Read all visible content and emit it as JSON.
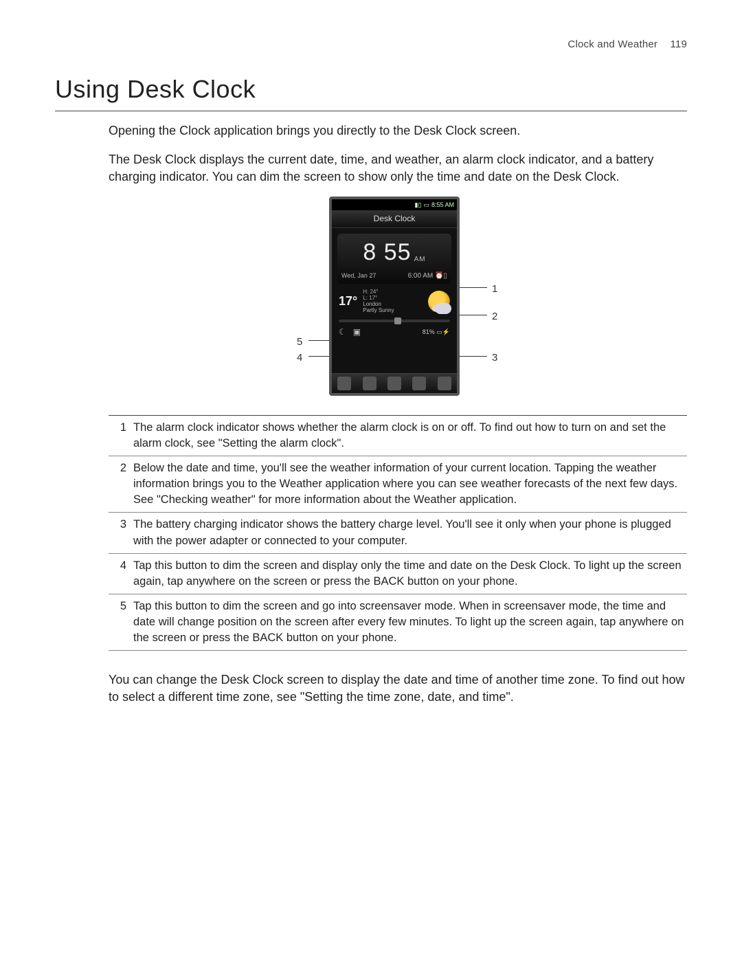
{
  "header": {
    "section": "Clock and Weather",
    "page_number": "119"
  },
  "title": "Using Desk Clock",
  "para1": "Opening the Clock application brings you directly to the Desk Clock screen.",
  "para2": "The Desk Clock displays the current date, time, and weather, an alarm clock indicator, and a battery charging indicator. You can dim the screen to show only the time and date on the Desk Clock.",
  "screenshot": {
    "status_time": "8:55 AM",
    "app_title": "Desk Clock",
    "big_time": "8 55",
    "big_ampm": "AM",
    "date": "Wed, Jan 27",
    "alarm_time": "6:00 AM",
    "temp": "17°",
    "hi": "H: 24°",
    "lo": "L: 17°",
    "city": "London",
    "condition": "Partly Sunny",
    "battery": "81%"
  },
  "callouts": {
    "c1": "1",
    "c2": "2",
    "c3": "3",
    "c4": "4",
    "c5": "5"
  },
  "explain": [
    {
      "num": "1",
      "text": "The alarm clock indicator shows whether the alarm clock is on or off. To find out how to turn on and set the alarm clock, see \"Setting the alarm clock\"."
    },
    {
      "num": "2",
      "text": "Below the date and time, you'll see the weather information of your current location. Tapping the weather information brings you to the Weather application where you can see weather forecasts of the next few days. See \"Checking weather\" for more information about the Weather application."
    },
    {
      "num": "3",
      "text": "The battery charging indicator shows the battery charge level. You'll see it only when your phone is plugged with the power adapter or connected to your computer."
    },
    {
      "num": "4",
      "text": "Tap this button to dim the screen and display only the time and date on the Desk Clock. To light up the screen again, tap anywhere on the screen or press the BACK button on your phone."
    },
    {
      "num": "5",
      "text": "Tap this button to dim the screen and go into screensaver mode. When in screensaver mode, the time and date will change position on the screen after every few minutes. To light up the screen again, tap anywhere on the screen or press the BACK button on your phone."
    }
  ],
  "closing": "You can change the Desk Clock screen to display the date and time of another time zone. To find out how to select a different time zone, see \"Setting the time zone, date, and time\"."
}
